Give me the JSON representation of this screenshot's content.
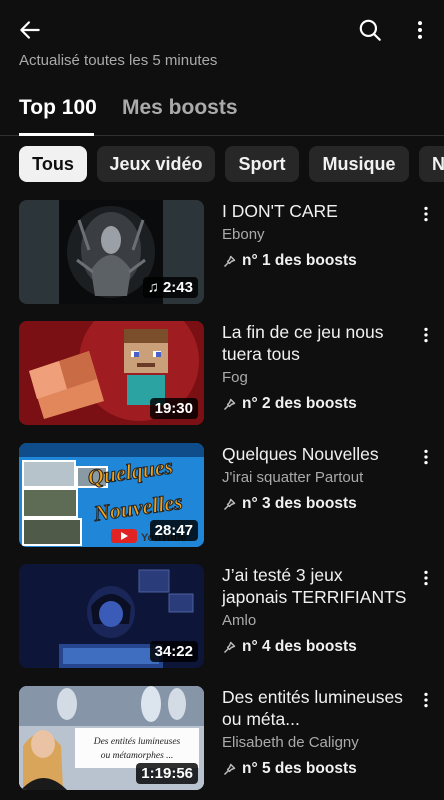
{
  "header": {
    "back_icon": "arrow-left-icon",
    "search_icon": "search-icon",
    "more_icon": "more-vertical-icon",
    "subtitle": "Actualisé toutes les 5 minutes"
  },
  "tabs": [
    {
      "label": "Top 100",
      "active": true
    },
    {
      "label": "Mes boosts",
      "active": false
    }
  ],
  "chips": [
    {
      "label": "Tous",
      "selected": true
    },
    {
      "label": "Jeux vidéo",
      "selected": false
    },
    {
      "label": "Sport",
      "selected": false
    },
    {
      "label": "Musique",
      "selected": false
    },
    {
      "label": "N",
      "selected": false
    }
  ],
  "videos": [
    {
      "title": "I DON'T CARE",
      "channel": "Ebony",
      "rank": "n° 1 des boosts",
      "duration": "2:43",
      "music": true
    },
    {
      "title": "La fin de ce jeu nous tuera tous",
      "channel": "Fog",
      "rank": "n° 2 des boosts",
      "duration": "19:30"
    },
    {
      "title": "Quelques Nouvelles",
      "channel": "J'irai squatter Partout",
      "rank": "n° 3 des boosts",
      "duration": "28:47",
      "thumb_text_1": "Quelques",
      "thumb_text_2": "Nouvelles",
      "thumb_text_3": "YouTube"
    },
    {
      "title": "J’ai testé 3 jeux japonais TERRIFIANTS",
      "channel": "Amlo",
      "rank": "n° 4 des boosts",
      "duration": "34:22"
    },
    {
      "title": "Des entités lumineuses ou méta...",
      "channel": "Elisabeth de Caligny",
      "rank": "n° 5 des boosts",
      "duration": "1:19:56",
      "thumb_text_1": "Des entités lumineuses",
      "thumb_text_2": "ou métamorphes ..."
    }
  ],
  "colors": {
    "background": "#0f0f0f",
    "chip": "#272727",
    "secondary_text": "#aaaaaa"
  }
}
